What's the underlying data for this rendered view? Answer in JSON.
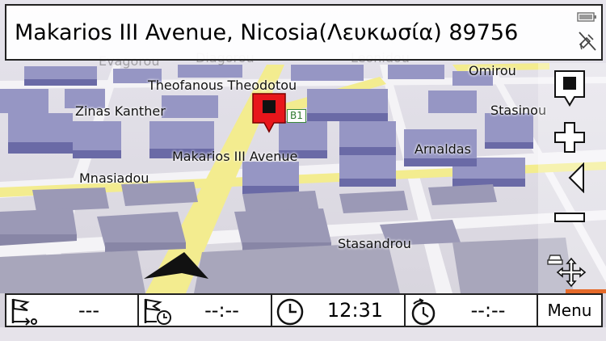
{
  "address": "Makarios III Avenue, Nicosia(Λευκωσία) 89756",
  "streets": {
    "evagorou": "Evagorou",
    "diagorou": "Diagorou",
    "leonidou": "Leonidou",
    "omirou": "Omirou",
    "theofanous": "Theofanous Theodotou",
    "zinas": "Zinas Kanther",
    "stasinou": "Stasinou",
    "makarios": "Makarios III Avenue",
    "arnaldas": "Arnaldas",
    "mnasiadou": "Mnasiadou",
    "stasandrou": "Stasandrou"
  },
  "road_shield": "B1",
  "bottom_bar": {
    "distance_to_destination": "---",
    "arrival_time": "--:--",
    "current_time": "12:31",
    "remaining_time": "--:--",
    "menu_label": "Menu"
  },
  "icons": {
    "destination_flag": "flag-route-icon",
    "arrival_flag": "flag-clock-icon",
    "clock": "clock-icon",
    "timer": "timer-icon",
    "battery": "battery-icon",
    "gps": "gps-off-icon",
    "pin": "map-pin-icon",
    "zoom_in": "zoom-in-icon",
    "zoom_out": "zoom-out-icon",
    "back": "back-arrow-icon",
    "stop": "stop-icon",
    "pan": "pan-move-icon",
    "traffic": "car-icon",
    "position": "position-arrow-icon"
  },
  "colors": {
    "building_top": "#9a9ac9",
    "building_side": "#6b6ba8",
    "road_main": "#f3ec8f",
    "ground": "#d9d6df",
    "pin": "#e8161b"
  }
}
